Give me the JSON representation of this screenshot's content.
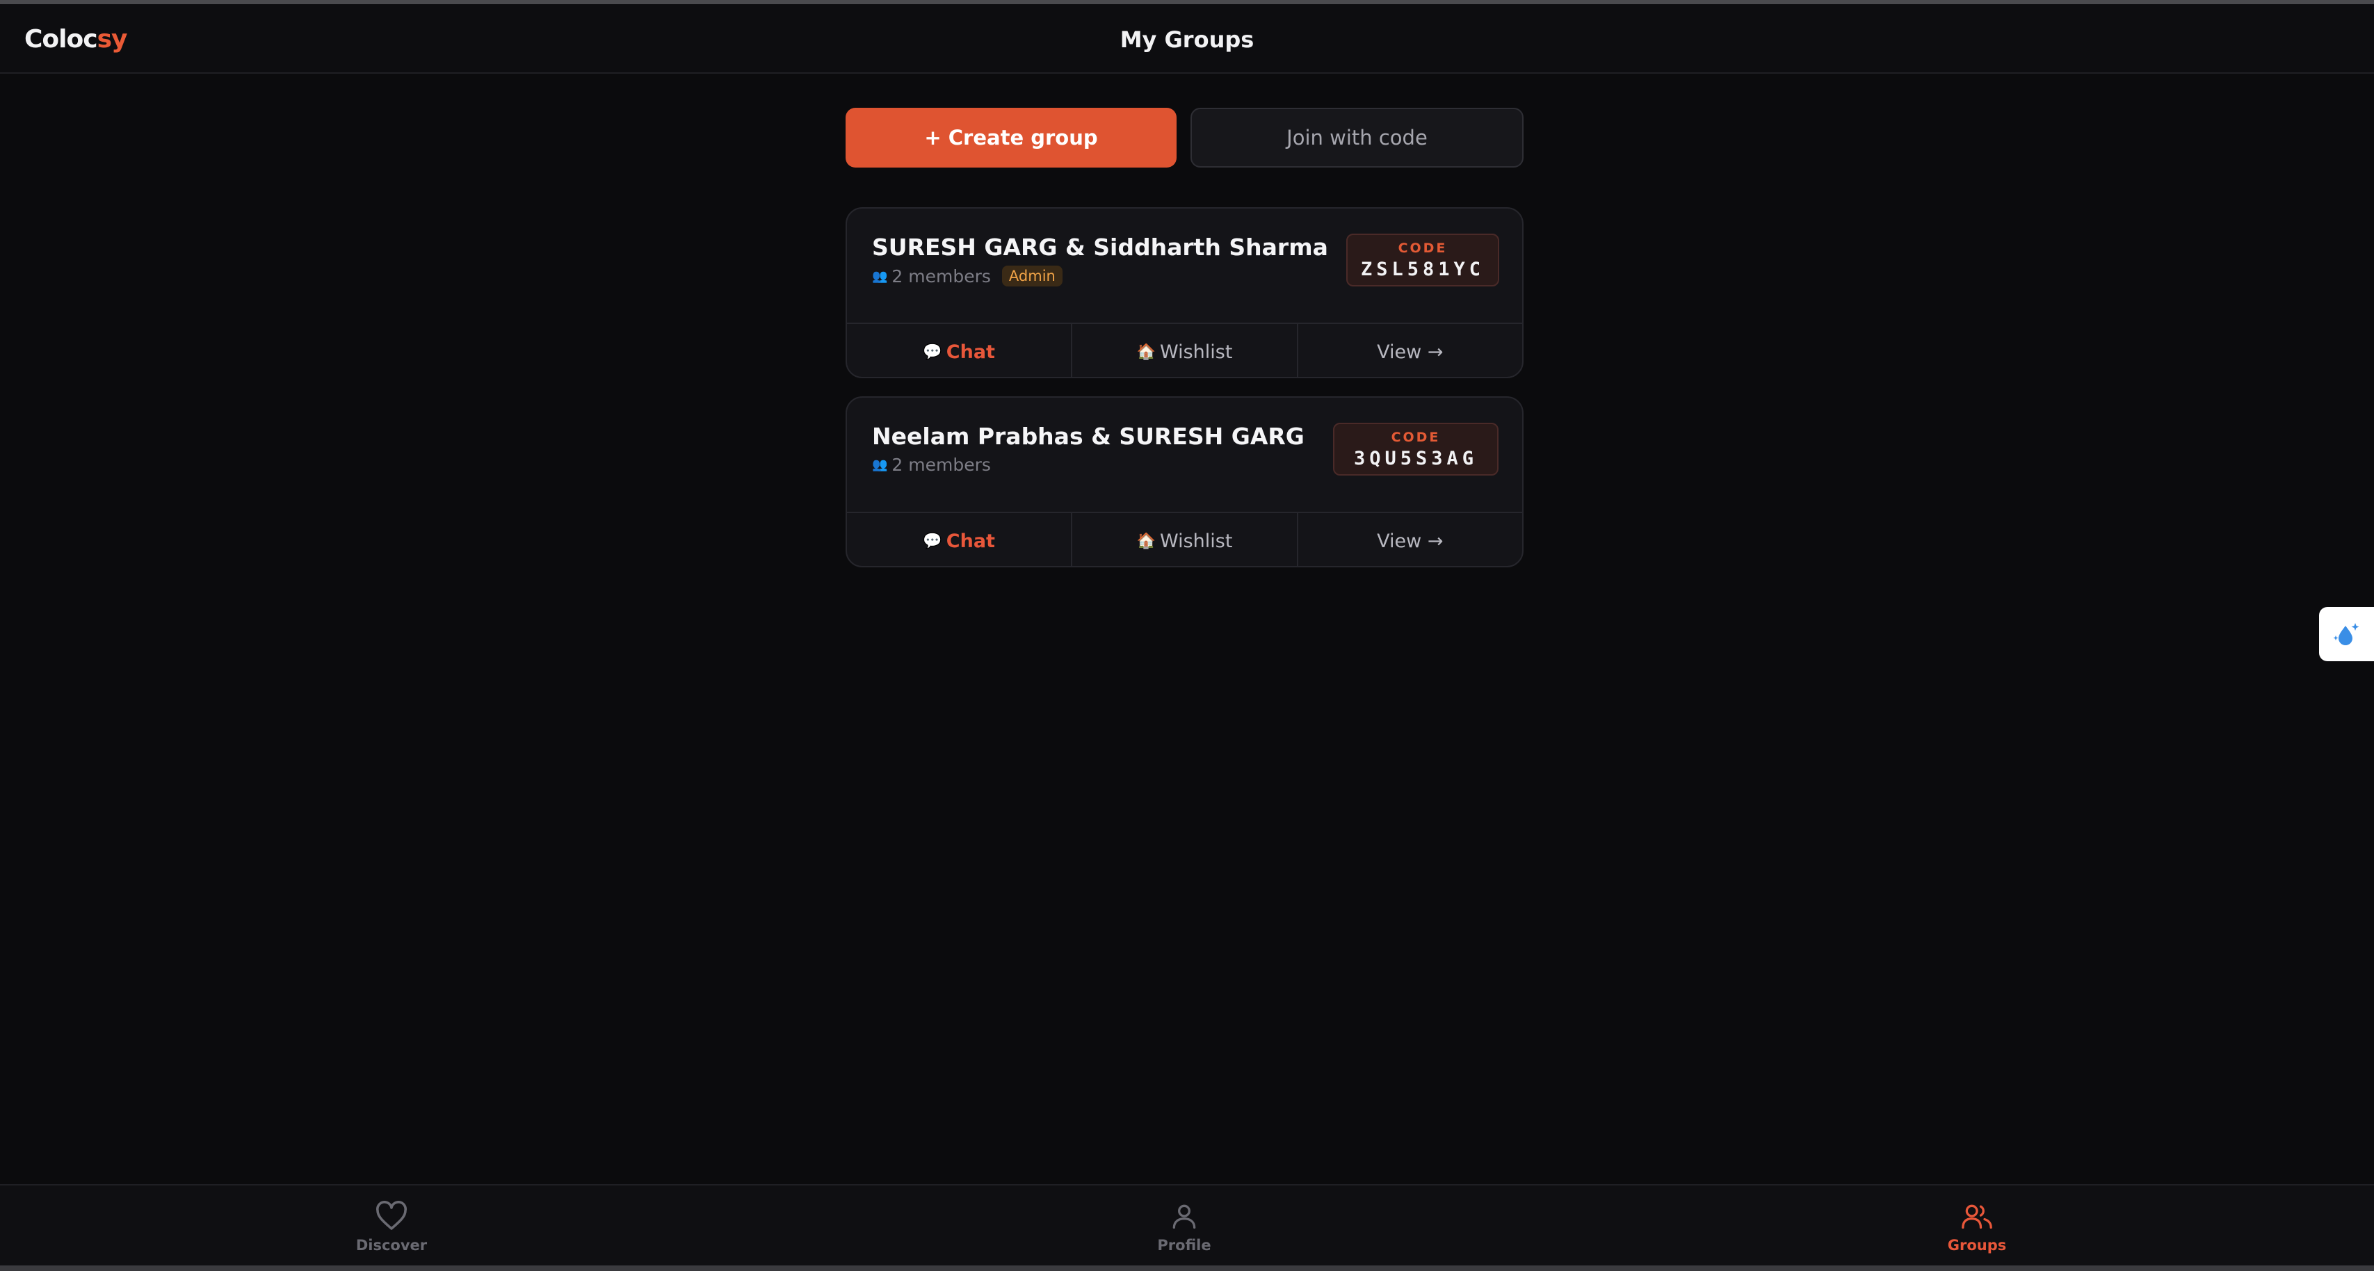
{
  "app": {
    "logo_main": "Coloc",
    "logo_accent": "sy",
    "page_title": "My Groups"
  },
  "actions": {
    "create_label": "+ Create group",
    "join_label": "Join with code"
  },
  "groups": [
    {
      "name": "SURESH GARG & Siddharth Sharma",
      "members": "2 members",
      "role": "Admin",
      "code_label": "CODE",
      "code": "ZSL581YC",
      "chat_label": "Chat",
      "wishlist_label": "Wishlist",
      "view_label": "View →"
    },
    {
      "name": "Neelam Prabhas & SURESH GARG",
      "members": "2 members",
      "code_label": "CODE",
      "code": "3QU5S3AG",
      "chat_label": "Chat",
      "wishlist_label": "Wishlist",
      "view_label": "View →"
    }
  ],
  "nav": {
    "discover": "Discover",
    "profile": "Profile",
    "groups": "Groups",
    "active": "groups"
  },
  "colors": {
    "accent": "#df5431",
    "background": "#0b0b0d",
    "card": "#141418"
  },
  "icons": {
    "members": "people-icon",
    "chat": "speech-bubble-icon",
    "wishlist": "house-icon",
    "discover": "heart-icon",
    "profile": "user-icon",
    "groups": "users-icon",
    "floating": "sparkle-drop-icon"
  }
}
